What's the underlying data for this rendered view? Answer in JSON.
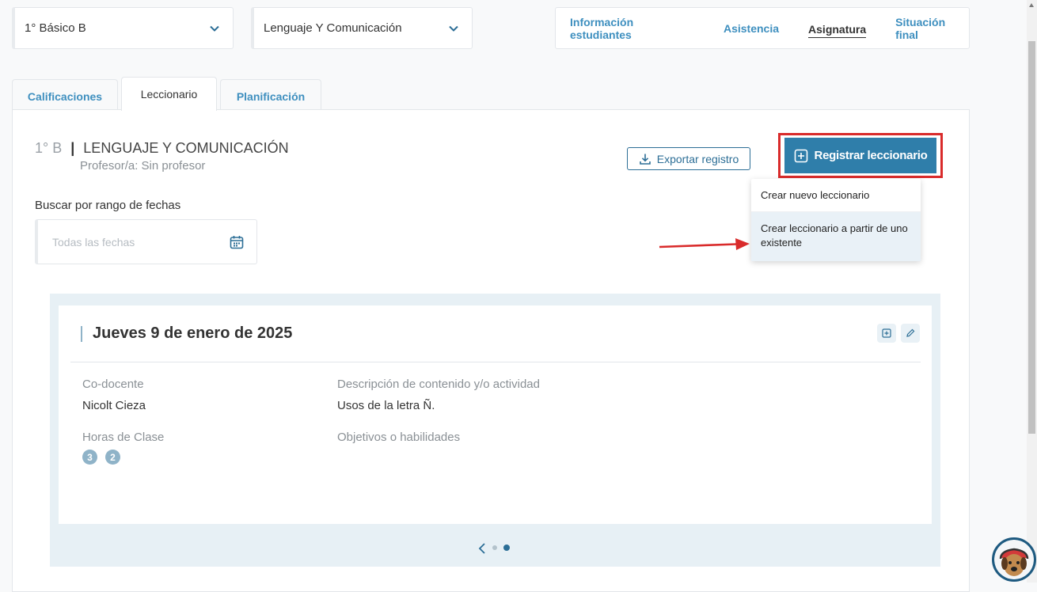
{
  "selectors": {
    "course": "1° Básico B",
    "subject": "Lenguaje Y Comunicación"
  },
  "topnav": {
    "items": [
      "Información estudiantes",
      "Asistencia",
      "Asignatura",
      "Situación final"
    ]
  },
  "tabs": [
    "Calificaciones",
    "Leccionario",
    "Planificación"
  ],
  "header": {
    "course_short": "1° B",
    "separator": "|",
    "subject_title": "LENGUAJE Y COMUNICACIÓN",
    "teacher": "Profesor/a: Sin profesor"
  },
  "export_label": "Exportar registro",
  "register_label": "Registrar leccionario",
  "menu": {
    "items": [
      "Crear nuevo leccionario",
      "Crear leccionario a partir de uno existente"
    ]
  },
  "date_filter": {
    "label": "Buscar por rango de fechas",
    "placeholder": "Todas las fechas"
  },
  "card": {
    "date": "Jueves 9 de enero de 2025",
    "codocente_label": "Co-docente",
    "codocente_value": "Nicolt Cieza",
    "descripcion_label": "Descripción de contenido y/o actividad",
    "descripcion_value": "Usos de la letra Ñ.",
    "horas_label": "Horas de Clase",
    "horas": [
      "3",
      "2"
    ],
    "objetivos_label": "Objetivos o habilidades"
  },
  "colors": {
    "accent": "#2f7eaa",
    "link": "#3e8fbf",
    "highlight_red": "#d92b2b"
  }
}
